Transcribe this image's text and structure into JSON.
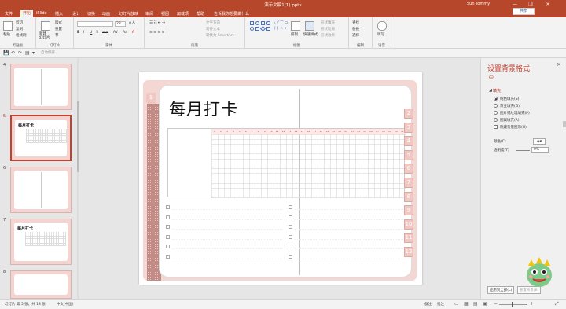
{
  "window": {
    "title": "演示文稿1(1).pptx",
    "user": "Sun Tommy",
    "share_label": "共享",
    "minimize": "—",
    "restore": "❐",
    "close": "✕"
  },
  "menu": {
    "tabs": [
      "文件",
      "开始",
      "iSlide",
      "插入",
      "设计",
      "切换",
      "动画",
      "幻灯片放映",
      "审阅",
      "视图",
      "加载项",
      "帮助"
    ],
    "active": "开始",
    "search": "告诉我你想要做什么"
  },
  "ribbon": {
    "groups": [
      "剪贴板",
      "幻灯片",
      "字体",
      "段落",
      "绘图",
      "编辑",
      "语音"
    ],
    "paste": "粘贴",
    "clipboard": [
      "剪切",
      "复制",
      "格式刷"
    ],
    "slides": {
      "new": "新建\n幻灯片",
      "items": [
        "版式",
        "重置",
        "节"
      ]
    },
    "font_size": "28",
    "font_buttons": [
      "B",
      "I",
      "U",
      "S",
      "abc",
      "AV",
      "Aa",
      "A"
    ],
    "paragraph": [
      "文字方向",
      "对齐文本",
      "转换为 SmartArt"
    ],
    "drawing": {
      "arrange": "排列",
      "quick_styles": "快速样式",
      "fill": "形状填充",
      "outline": "形状轮廓",
      "effects": "形状效果"
    },
    "editing": [
      "查找",
      "替换",
      "选择"
    ],
    "voice": "听写"
  },
  "qat": {
    "items": [
      "💾",
      "↶",
      "↷",
      "▤",
      "▾"
    ],
    "note": "自动保存"
  },
  "thumbnails": [
    {
      "num": "4",
      "title": ""
    },
    {
      "num": "5",
      "title": "每月打卡"
    },
    {
      "num": "6",
      "title": ""
    },
    {
      "num": "7",
      "title": "每月打卡"
    },
    {
      "num": "8",
      "title": ""
    }
  ],
  "slide": {
    "title": "每月打卡",
    "days": [
      "1",
      "2",
      "3",
      "4",
      "5",
      "6",
      "7",
      "8",
      "9",
      "10",
      "11",
      "12",
      "13",
      "14",
      "15",
      "16",
      "17",
      "18",
      "19",
      "20",
      "21",
      "22",
      "23",
      "24",
      "25",
      "26",
      "27",
      "28",
      "29",
      "30",
      "31"
    ],
    "right_tabs": [
      "2",
      "3",
      "4",
      "5",
      "6",
      "7",
      "8",
      "9",
      "10",
      "11",
      "12"
    ],
    "left_tab": "1"
  },
  "panel": {
    "title": "设置背景格式",
    "close": "×",
    "section": "填充",
    "options": [
      "纯色填充(S)",
      "渐变填充(G)",
      "图片或纹理填充(P)",
      "图案填充(A)",
      "隐藏背景图形(H)"
    ],
    "color_label": "颜色(C)",
    "transparency_label": "透明度(T)",
    "transparency_value": "0%",
    "apply_all": "应用到全部(L)",
    "reset": "重置背景(B)"
  },
  "status": {
    "slide": "幻灯片 第 5 张，共 18 张",
    "lang": "中文(中国)",
    "notes": "备注",
    "comments": "批注",
    "zoom": "+"
  },
  "colors": {
    "accent": "#b7472a",
    "paper": "#f4d6d2",
    "tab": "#f0c8c3"
  }
}
